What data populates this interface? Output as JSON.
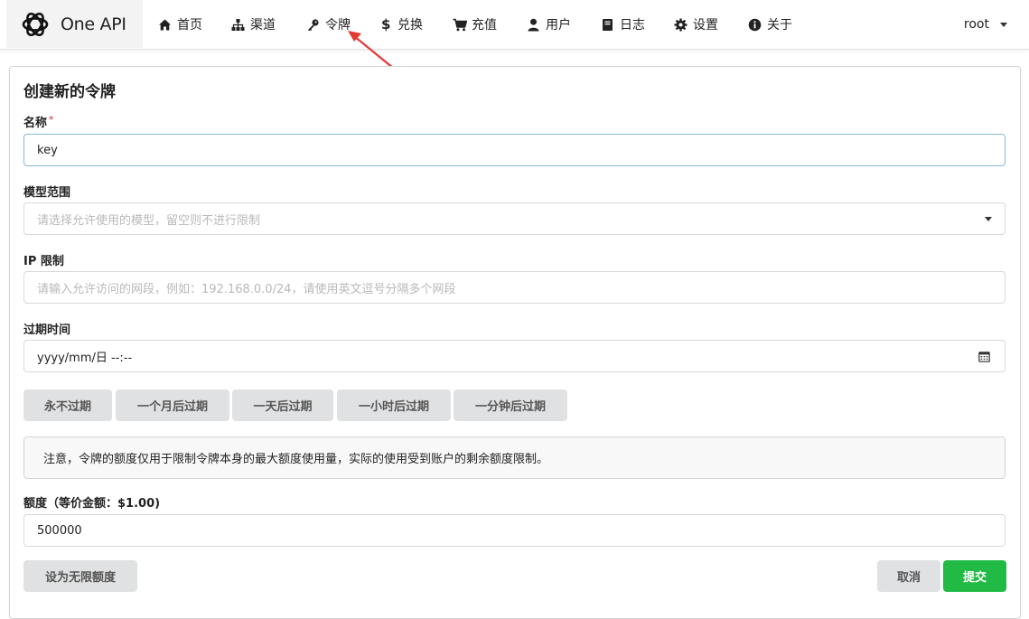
{
  "navbar": {
    "brand": "One API",
    "items": [
      {
        "label": "首页",
        "icon": "home-icon"
      },
      {
        "label": "渠道",
        "icon": "sitemap-icon"
      },
      {
        "label": "令牌",
        "icon": "key-icon"
      },
      {
        "label": "兑换",
        "icon": "dollar-icon"
      },
      {
        "label": "充值",
        "icon": "cart-icon"
      },
      {
        "label": "用户",
        "icon": "user-icon"
      },
      {
        "label": "日志",
        "icon": "book-icon"
      },
      {
        "label": "设置",
        "icon": "gear-icon"
      },
      {
        "label": "关于",
        "icon": "info-icon"
      }
    ],
    "user": "root"
  },
  "form": {
    "title": "创建新的令牌",
    "name": {
      "label": "名称",
      "required_mark": "*",
      "value": "key"
    },
    "models": {
      "label": "模型范围",
      "placeholder": "请选择允许使用的模型，留空则不进行限制"
    },
    "ip": {
      "label": "IP 限制",
      "placeholder": "请输入允许访问的网段，例如：192.168.0.0/24，请使用英文逗号分隔多个网段"
    },
    "expire": {
      "label": "过期时间",
      "value": "yyyy/mm/日 --:--"
    },
    "expire_buttons": [
      "永不过期",
      "一个月后过期",
      "一天后过期",
      "一小时后过期",
      "一分钟后过期"
    ],
    "notice": "注意，令牌的额度仅用于限制令牌本身的最大额度使用量，实际的使用受到账户的剩余额度限制。",
    "quota": {
      "label": "额度（等价金额：$1.00)",
      "value": "500000"
    },
    "unlimited_button": "设为无限额度",
    "cancel_button": "取消",
    "submit_button": "提交"
  },
  "colors": {
    "submit": "#21ba45",
    "annotation_arrow": "#e53935",
    "focus_border": "#85b7d9"
  }
}
